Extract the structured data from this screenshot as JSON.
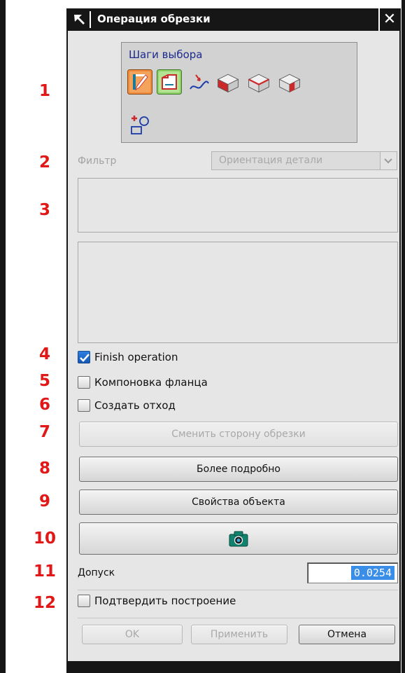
{
  "dialog": {
    "title": "Операция обрезки",
    "close_label": "✕"
  },
  "annotations": [
    "1",
    "2",
    "3",
    "4",
    "5",
    "6",
    "7",
    "8",
    "9",
    "10",
    "11",
    "12"
  ],
  "selection_steps": {
    "title": "Шаги выбора",
    "icons": [
      "pencil-selection-step-icon",
      "sheet-selection-step-icon",
      "curve-selection-step-icon",
      "solid-face-icon",
      "solid-edge-icon",
      "solid-corner-icon",
      "add-point-icon"
    ]
  },
  "filter": {
    "label": "Фильтр",
    "value": "Ориентация детали"
  },
  "options": {
    "finish_operation": {
      "label": "Finish operation",
      "checked": true
    },
    "flange_layout": {
      "label": "Компоновка фланца",
      "checked": false
    },
    "create_scrap": {
      "label": "Создать отход",
      "checked": false
    }
  },
  "buttons": {
    "change_side": "Сменить сторону обрезки",
    "more_details": "Более подробно",
    "object_properties": "Свойства объекта",
    "camera_icon": "camera-icon",
    "ok": "OK",
    "apply": "Применить",
    "cancel": "Отмена"
  },
  "tolerance": {
    "label": "Допуск",
    "value": "0.0254"
  },
  "confirm_build": {
    "label": "Подтвердить построение",
    "checked": false
  },
  "colors": {
    "annotation": "#e01818",
    "titlebar": "#161616",
    "panel": "#e6e6e6",
    "active_step_orange": "#f08a3c",
    "active_step_green": "#8fd06a",
    "selection_title": "#1c2a8c",
    "tolerance_highlight": "#3b8ee8"
  }
}
